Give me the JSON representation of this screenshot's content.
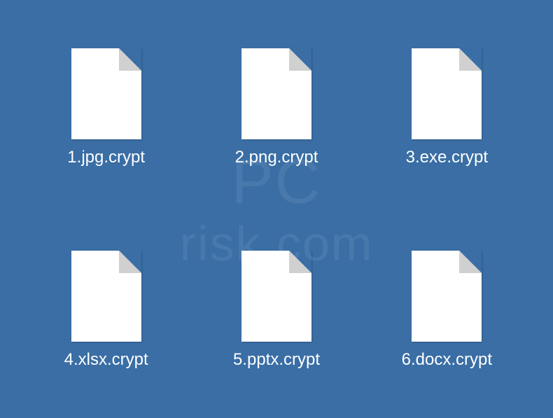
{
  "files": [
    {
      "name": "1.jpg.crypt"
    },
    {
      "name": "2.png.crypt"
    },
    {
      "name": "3.exe.crypt"
    },
    {
      "name": "4.xlsx.crypt"
    },
    {
      "name": "5.pptx.crypt"
    },
    {
      "name": "6.docx.crypt"
    }
  ],
  "watermark": {
    "line1": "PC",
    "line2": "risk.com"
  }
}
